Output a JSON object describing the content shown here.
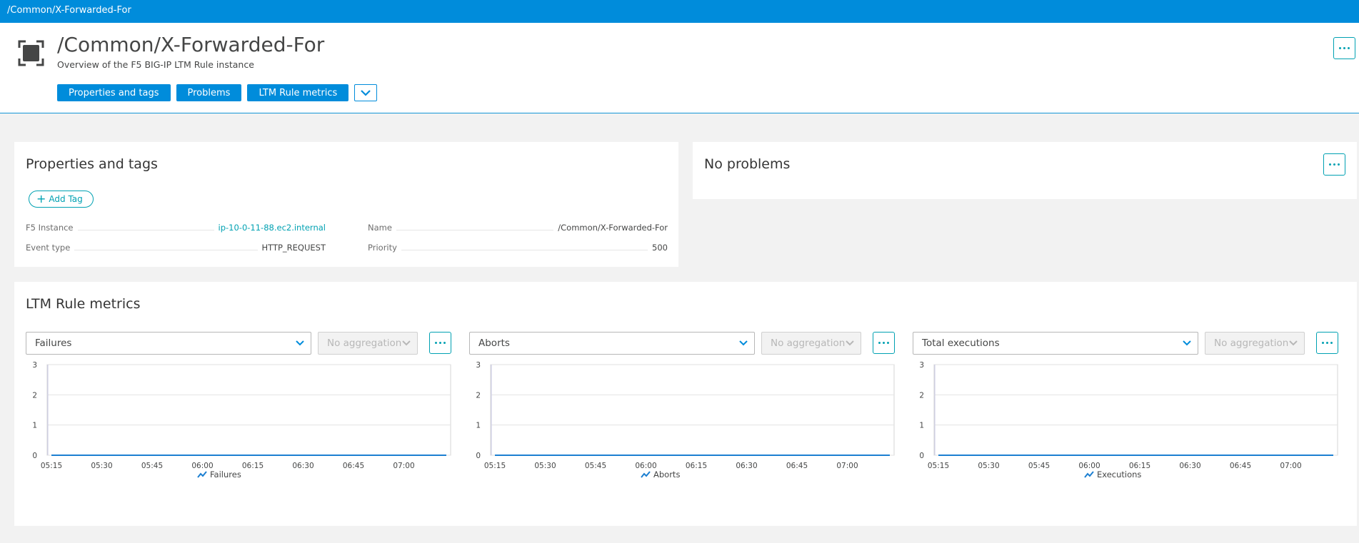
{
  "topbar": {
    "title": "/Common/X-Forwarded-For"
  },
  "header": {
    "title": "/Common/X-Forwarded-For",
    "subtitle": "Overview of the F5 BIG-IP LTM Rule instance",
    "nav": [
      "Properties and tags",
      "Problems",
      "LTM Rule metrics"
    ],
    "icons": [
      "entity-icon",
      "chevron-down-icon",
      "more-icon"
    ]
  },
  "properties": {
    "title": "Properties and tags",
    "add_tag": "Add Tag",
    "items": [
      {
        "key": "F5 Instance",
        "value": "ip-10-0-11-88.ec2.internal"
      },
      {
        "key": "Name",
        "value": "/Common/X-Forwarded-For"
      },
      {
        "key": "Event type",
        "value": "HTTP_REQUEST"
      },
      {
        "key": "Priority",
        "value": "500"
      }
    ]
  },
  "problems": {
    "title": "No problems"
  },
  "metrics": {
    "title": "LTM Rule metrics",
    "aggregation_placeholder": "No aggregation",
    "charts": [
      {
        "metric": "Failures",
        "legend": "Failures"
      },
      {
        "metric": "Aborts",
        "legend": "Aborts"
      },
      {
        "metric": "Total executions",
        "legend": "Executions"
      }
    ]
  },
  "colors": {
    "brand": "#008cdb",
    "accent": "#00a1b2",
    "series": "#1c7fd1"
  },
  "chart_data": [
    {
      "type": "line",
      "x": [
        "05:15",
        "05:30",
        "05:45",
        "06:00",
        "06:15",
        "06:30",
        "06:45",
        "07:00"
      ],
      "series": [
        {
          "name": "Failures",
          "values": [
            0,
            0,
            0,
            0,
            0,
            0,
            0,
            0
          ]
        }
      ],
      "y_ticks": [
        "0",
        "1",
        "2",
        "3"
      ],
      "ylim": [
        0,
        3
      ],
      "grid": true
    },
    {
      "type": "line",
      "x": [
        "05:15",
        "05:30",
        "05:45",
        "06:00",
        "06:15",
        "06:30",
        "06:45",
        "07:00"
      ],
      "series": [
        {
          "name": "Aborts",
          "values": [
            0,
            0,
            0,
            0,
            0,
            0,
            0,
            0
          ]
        }
      ],
      "y_ticks": [
        "0",
        "1",
        "2",
        "3"
      ],
      "ylim": [
        0,
        3
      ],
      "grid": true
    },
    {
      "type": "line",
      "x": [
        "05:15",
        "05:30",
        "05:45",
        "06:00",
        "06:15",
        "06:30",
        "06:45",
        "07:00"
      ],
      "series": [
        {
          "name": "Executions",
          "values": [
            0,
            0,
            0,
            0,
            0,
            0,
            0,
            0
          ]
        }
      ],
      "y_ticks": [
        "0",
        "1",
        "2",
        "3"
      ],
      "ylim": [
        0,
        3
      ],
      "grid": true
    }
  ]
}
